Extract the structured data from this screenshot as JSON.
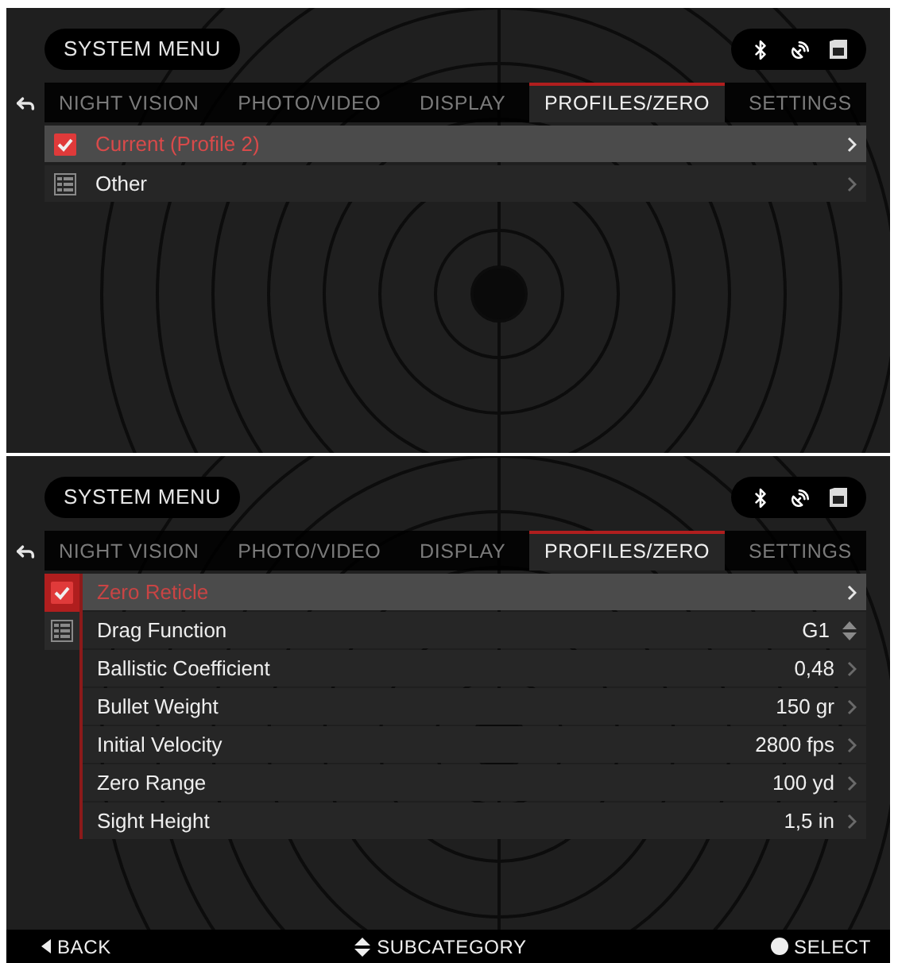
{
  "screens": [
    {
      "title": "SYSTEM MENU",
      "tabs": [
        {
          "label": "NIGHT VISION",
          "selected": false
        },
        {
          "label": "PHOTO/VIDEO",
          "selected": false
        },
        {
          "label": "DISPLAY",
          "selected": false
        },
        {
          "label": "PROFILES/ZERO",
          "selected": true
        },
        {
          "label": "SETTINGS",
          "selected": false
        }
      ],
      "menu_items": [
        {
          "kind": "check",
          "label": "Current (Profile 2)",
          "selected": true
        },
        {
          "kind": "list",
          "label": "Other",
          "selected": false
        }
      ]
    },
    {
      "title": "SYSTEM MENU",
      "tabs": [
        {
          "label": "NIGHT VISION",
          "selected": false
        },
        {
          "label": "PHOTO/VIDEO",
          "selected": false
        },
        {
          "label": "DISPLAY",
          "selected": false
        },
        {
          "label": "PROFILES/ZERO",
          "selected": true
        },
        {
          "label": "SETTINGS",
          "selected": false
        }
      ],
      "categories": [
        {
          "kind": "check",
          "selected": true
        },
        {
          "kind": "list",
          "selected": false
        }
      ],
      "settings": [
        {
          "label": "Zero Reticle",
          "selected": true,
          "kind": "link"
        },
        {
          "label": "Drag Function",
          "value": "G1",
          "selected": false,
          "kind": "stepper"
        },
        {
          "label": "Ballistic Coefficient",
          "value": "0,48",
          "selected": false,
          "kind": "link"
        },
        {
          "label": "Bullet Weight",
          "value": "150 gr",
          "selected": false,
          "kind": "link"
        },
        {
          "label": "Initial Velocity",
          "value": "2800 fps",
          "selected": false,
          "kind": "link"
        },
        {
          "label": "Zero Range",
          "value": "100 yd",
          "selected": false,
          "kind": "link"
        },
        {
          "label": "Sight Height",
          "value": "1,5 in",
          "selected": false,
          "kind": "link"
        }
      ],
      "footer": {
        "back": "BACK",
        "subcategory": "SUBCATEGORY",
        "select": "SELECT"
      }
    }
  ]
}
